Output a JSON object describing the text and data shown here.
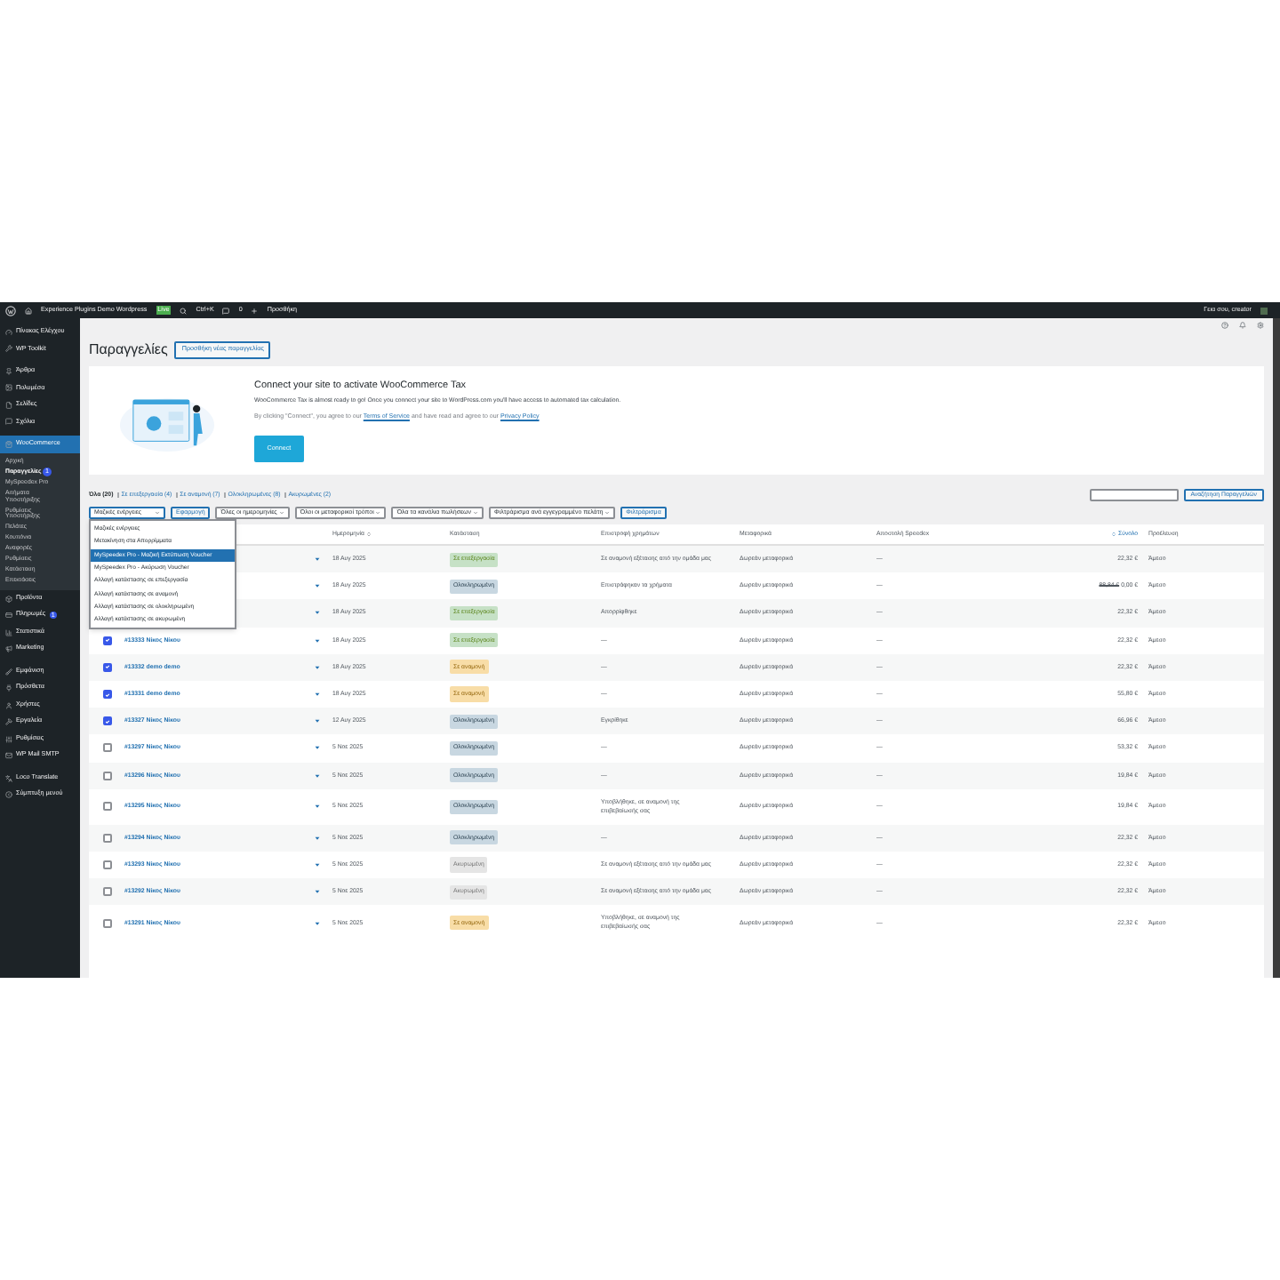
{
  "admin_bar": {
    "site": "Experience Plugins Demo Wordpress",
    "site_badge": "Live",
    "shortcut": "Ctrl+K",
    "comments": "0",
    "new": "Προσθήκη",
    "greeting": "Γεια σου, creator"
  },
  "sidebar": {
    "sections": [
      [
        {
          "label": "Πίνακας Ελέγχου",
          "selected": false
        },
        {
          "label": "WP Toolkit",
          "selected": false
        }
      ],
      [
        {
          "label": "Άρθρα",
          "selected": false
        },
        {
          "label": "Πολυμέσα",
          "selected": false
        },
        {
          "label": "Σελίδες",
          "selected": false
        },
        {
          "label": "Σχόλια",
          "selected": false
        }
      ],
      [
        {
          "label": "WooCommerce",
          "selected": true,
          "children": [
            {
              "label": "Αρχική",
              "selected": false
            },
            {
              "label": "Παραγγελίες",
              "selected": true,
              "badge": "1"
            },
            {
              "label": "MySpeedex Pro",
              "selected": false
            },
            {
              "label": "Αιτήματα Υποστήριξης",
              "selected": false
            },
            {
              "label": "Ρυθμίσεις Υποστήριξης",
              "selected": false
            },
            {
              "label": "Πελάτες",
              "selected": false
            },
            {
              "label": "Κουπόνια",
              "selected": false
            },
            {
              "label": "Αναφορές",
              "selected": false
            },
            {
              "label": "Ρυθμίσεις",
              "selected": false
            },
            {
              "label": "Κατάσταση",
              "selected": false
            },
            {
              "label": "Επεκτάσεις",
              "selected": false
            }
          ]
        },
        {
          "label": "Προϊόντα",
          "selected": false
        },
        {
          "label": "Πληρωμές",
          "selected": false,
          "badge": "1"
        },
        {
          "label": "Στατιστικά",
          "selected": false
        },
        {
          "label": "Marketing",
          "selected": false
        }
      ],
      [
        {
          "label": "Εμφάνιση",
          "selected": false
        },
        {
          "label": "Πρόσθετα",
          "selected": false
        },
        {
          "label": "Χρήστες",
          "selected": false
        },
        {
          "label": "Εργαλεία",
          "selected": false
        },
        {
          "label": "Ρυθμίσεις",
          "selected": false
        },
        {
          "label": "WP Mail SMTP",
          "selected": false
        }
      ],
      [
        {
          "label": "Loco Translate",
          "selected": false
        },
        {
          "label": "Σύμπτυξη μενού",
          "selected": false
        }
      ]
    ]
  },
  "page": {
    "title": "Παραγγελίες",
    "add_button": "Προσθήκη νέας παραγγελίας"
  },
  "banner": {
    "title": "Connect your site to activate WooCommerce Tax",
    "text": "WooCommerce Tax is almost ready to go! Once you connect your site to WordPress.com you'll have access to automated tax calculation.",
    "fine_print": "By clicking \"Connect\", you agree to our",
    "fine_link_1": "Terms of Service",
    "fine_mid": "and have read and agree to our",
    "fine_link_2": "Privacy Policy",
    "button": "Connect"
  },
  "status_links": [
    {
      "label": "Όλα (20)",
      "selected": true
    },
    {
      "label": "Σε επεξεργασία (4)",
      "selected": false
    },
    {
      "label": "Σε αναμονή (7)",
      "selected": false
    },
    {
      "label": "Ολοκληρωμένες (8)",
      "selected": false
    },
    {
      "label": "Ακυρωμένες (2)",
      "selected": false
    }
  ],
  "search": {
    "button": "Αναζήτηση Παραγγελιών"
  },
  "filters": {
    "bulk": "Μαζικές ενέργειες",
    "apply": "Εφαρμογή",
    "selects": [
      "Όλες οι ημερομηνίες",
      "Όλοι οι μεταφορικοί τρόποι",
      "Όλα τα κανάλια πωλήσεων",
      "Φιλτράρισμα ανά εγγεγραμμένο πελάτη"
    ],
    "filter": "Φιλτράρισμα"
  },
  "bulk_menu": [
    {
      "label": "Μαζικές ενέργειες",
      "selected": false
    },
    {
      "label": "Μετακίνηση στα Απορρίμματα",
      "selected": false
    },
    {
      "label": "MySpeedex Pro - Μαζική Εκτύπωση Voucher",
      "selected": true
    },
    {
      "label": "MySpeedex Pro - Ακύρωση Voucher",
      "selected": false
    },
    {
      "label": "Αλλαγή κατάστασης σε επεξεργασία",
      "selected": false
    },
    {
      "label": "Αλλαγή κατάστασης σε αναμονή",
      "selected": false
    },
    {
      "label": "Αλλαγή κατάστασης σε ολοκληρωμένη",
      "selected": false
    },
    {
      "label": "Αλλαγή κατάστασης σε ακυρωμένη",
      "selected": false
    }
  ],
  "table": {
    "columns": [
      "Ημερομηνία",
      "Κατάσταση",
      "Επιστροφή χρημάτων",
      "Μεταφορικά",
      "Αποστολή Speedex",
      "Σύνολο",
      "Προέλευση"
    ],
    "rows": [
      {
        "date": "18 Αυγ 2025",
        "status": "Σε επεξεργασία",
        "kind": "processing",
        "refund": "Σε αναμονή εξέτασης από την ομάδα μας",
        "shipping": "Δωρεάν μεταφορικά",
        "speedex": "—",
        "total": "22,32 €",
        "origin": "Άμεσο"
      },
      {
        "date": "18 Αυγ 2025",
        "status": "Ολοκληρωμένη",
        "kind": "completed",
        "refund": "Επιστράφηκαν τα χρήματα",
        "shipping": "Δωρεάν μεταφορικά",
        "speedex": "—",
        "total_old": "88,84 €",
        "total": "0,00 €",
        "origin": "Άμεσο"
      },
      {
        "date": "18 Αυγ 2025",
        "status": "Σε επεξεργασία",
        "kind": "processing",
        "refund": "Απορρίφθηκε",
        "shipping": "Δωρεάν μεταφορικά",
        "speedex": "—",
        "total": "22,32 €",
        "origin": "Άμεσο"
      },
      {
        "checked": true,
        "order": "#13333 Νίκος Νίκου",
        "date": "18 Αυγ 2025",
        "status": "Σε επεξεργασία",
        "kind": "processing",
        "refund": "—",
        "shipping": "Δωρεάν μεταφορικά",
        "speedex": "—",
        "total": "22,32 €",
        "origin": "Άμεσο"
      },
      {
        "checked": true,
        "order": "#13332 demo demo",
        "date": "18 Αυγ 2025",
        "status": "Σε αναμονή",
        "kind": "on-hold",
        "refund": "—",
        "shipping": "Δωρεάν μεταφορικά",
        "speedex": "—",
        "total": "22,32 €",
        "origin": "Άμεσο"
      },
      {
        "checked": true,
        "order": "#13331 demo demo",
        "date": "18 Αυγ 2025",
        "status": "Σε αναμονή",
        "kind": "on-hold",
        "refund": "—",
        "shipping": "Δωρεάν μεταφορικά",
        "speedex": "—",
        "total": "55,80 €",
        "origin": "Άμεσο"
      },
      {
        "checked": true,
        "order": "#13327 Νίκος Νίκου",
        "date": "12 Αυγ 2025",
        "status": "Ολοκληρωμένη",
        "kind": "completed",
        "refund": "Εγκρίθηκε",
        "shipping": "Δωρεάν μεταφορικά",
        "speedex": "—",
        "total": "66,96 €",
        "origin": "Άμεσο"
      },
      {
        "checked": false,
        "order": "#13297 Νίκος Νίκου",
        "date": "5 Νοε 2025",
        "status": "Ολοκληρωμένη",
        "kind": "completed",
        "refund": "—",
        "shipping": "Δωρεάν μεταφορικά",
        "speedex": "—",
        "total": "53,32 €",
        "origin": "Άμεσο"
      },
      {
        "checked": false,
        "order": "#13296 Νίκος Νίκου",
        "date": "5 Νοε 2025",
        "status": "Ολοκληρωμένη",
        "kind": "completed",
        "refund": "—",
        "shipping": "Δωρεάν μεταφορικά",
        "speedex": "—",
        "total": "19,84 €",
        "origin": "Άμεσο"
      },
      {
        "checked": false,
        "order": "#13295 Νίκος Νίκου",
        "date": "5 Νοε 2025",
        "status": "Ολοκληρωμένη",
        "kind": "completed",
        "refund": "Υποβλήθηκε, σε αναμονή της επιβεβαίωσής σας",
        "shipping": "Δωρεάν μεταφορικά",
        "speedex": "—",
        "total": "19,84 €",
        "origin": "Άμεσο"
      },
      {
        "checked": false,
        "order": "#13294 Νίκος Νίκου",
        "date": "5 Νοε 2025",
        "status": "Ολοκληρωμένη",
        "kind": "completed",
        "refund": "—",
        "shipping": "Δωρεάν μεταφορικά",
        "speedex": "—",
        "total": "22,32 €",
        "origin": "Άμεσο"
      },
      {
        "checked": false,
        "order": "#13293 Νίκος Νίκου",
        "date": "5 Νοε 2025",
        "status": "Ακυρωμένη",
        "kind": "cancelled",
        "refund": "Σε αναμονή εξέτασης από την ομάδα μας",
        "shipping": "Δωρεάν μεταφορικά",
        "speedex": "—",
        "total": "22,32 €",
        "origin": "Άμεσο"
      },
      {
        "checked": false,
        "order": "#13292 Νίκος Νίκου",
        "date": "5 Νοε 2025",
        "status": "Ακυρωμένη",
        "kind": "cancelled",
        "refund": "Σε αναμονή εξέτασης από την ομάδα μας",
        "shipping": "Δωρεάν μεταφορικά",
        "speedex": "—",
        "total": "22,32 €",
        "origin": "Άμεσο"
      },
      {
        "checked": false,
        "order": "#13291 Νίκος Νίκου",
        "date": "5 Νοε 2025",
        "status": "Σε αναμονή",
        "kind": "on-hold",
        "refund": "Υποβλήθηκε, σε αναμονή της επιβεβαίωσής σας",
        "shipping": "Δωρεάν μεταφορικά",
        "speedex": "—",
        "total": "22,32 €",
        "origin": "Άμεσο"
      }
    ]
  }
}
